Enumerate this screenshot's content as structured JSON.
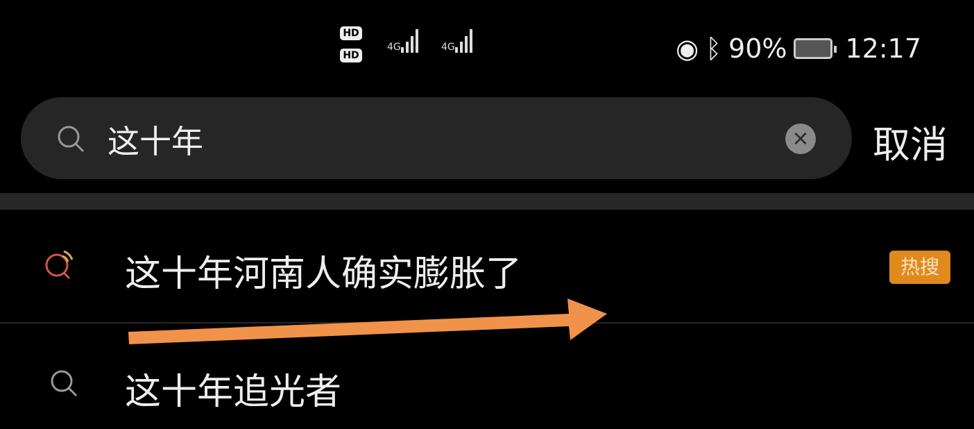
{
  "status_bar": {
    "sim1": "HD",
    "sim2": "HD",
    "network1": "4G",
    "network2": "4G",
    "battery": "90%",
    "time": "12:17"
  },
  "search": {
    "query": "这十年",
    "cancel_label": "取消"
  },
  "results": [
    {
      "label": "这十年河南人确实膨胀了",
      "badge": "热搜",
      "icon": "hot-search-icon"
    },
    {
      "label": "这十年追光者",
      "icon": "search-icon"
    }
  ],
  "colors": {
    "badge": "#e08a1e",
    "arrow": "#f0924a",
    "hot_icon": "#d9534f"
  }
}
